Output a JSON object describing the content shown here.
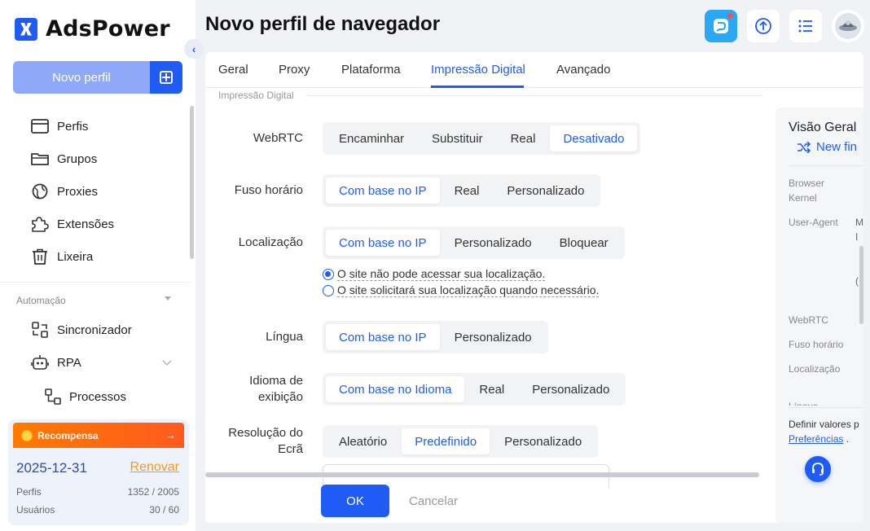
{
  "app": {
    "brand": "AdsPower",
    "page_title": "Novo perfil de navegador"
  },
  "sidebar": {
    "new_profile_label": "Novo perfil",
    "items": [
      {
        "label": "Perfis",
        "icon": "browser-window-icon"
      },
      {
        "label": "Grupos",
        "icon": "folder-icon"
      },
      {
        "label": "Proxies",
        "icon": "globe-icon"
      },
      {
        "label": "Extensões",
        "icon": "puzzle-icon"
      },
      {
        "label": "Lixeira",
        "icon": "trash-icon"
      }
    ],
    "automation_title": "Automação",
    "automation_items": [
      {
        "label": "Sincronizador",
        "icon": "sync-icon"
      },
      {
        "label": "RPA",
        "icon": "robot-icon"
      }
    ],
    "rpa_sub_item": "Processos"
  },
  "reward": {
    "title": "Recompensa",
    "arrow": "→",
    "date": "2025-12-31",
    "renew": "Renovar",
    "profiles_label": "Perfis",
    "profiles_value": "1352 / 2005",
    "users_label": "Usuários",
    "users_value": "30 / 60"
  },
  "tabs": [
    "Geral",
    "Proxy",
    "Plataforma",
    "Impressão Digital",
    "Avançado"
  ],
  "active_tab": "Impressão Digital",
  "section_label": "Impressão Digital",
  "form": {
    "webrtc": {
      "label": "WebRTC",
      "options": [
        "Encaminhar",
        "Substituir",
        "Real",
        "Desativado"
      ],
      "selected": "Desativado"
    },
    "timezone": {
      "label": "Fuso horário",
      "options": [
        "Com base no IP",
        "Real",
        "Personalizado"
      ],
      "selected": "Com base no IP"
    },
    "location": {
      "label": "Localização",
      "options": [
        "Com base no IP",
        "Personalizado",
        "Bloquear"
      ],
      "selected": "Com base no IP",
      "radios": [
        {
          "text": "O site não pode acessar sua localização.",
          "checked": true
        },
        {
          "text": "O site solicitará sua localização quando necessário.",
          "checked": false
        }
      ]
    },
    "language": {
      "label": "Língua",
      "options": [
        "Com base no IP",
        "Personalizado"
      ],
      "selected": "Com base no IP"
    },
    "display_language": {
      "label_line1": "Idioma de",
      "label_line2": "exibição",
      "options": [
        "Com base no Idioma",
        "Real",
        "Personalizado"
      ],
      "selected": "Com base no Idioma"
    },
    "resolution": {
      "label_line1": "Resolução do",
      "label_line2": "Ecrã",
      "options": [
        "Aleatório",
        "Predefinido",
        "Personalizado"
      ],
      "selected": "Predefinido"
    }
  },
  "buttons": {
    "ok": "OK",
    "cancel": "Cancelar"
  },
  "overview": {
    "title": "Visão Geral",
    "new_fingerprint": "New fin",
    "keys": {
      "browser_kernel_1": "Browser",
      "browser_kernel_2": "Kernel",
      "user_agent": "User-Agent",
      "user_agent_val_1": "M",
      "user_agent_val_2": "I",
      "user_agent_val_3": "(",
      "webrtc": "WebRTC",
      "timezone": "Fuso horário",
      "location": "Localização",
      "language": "Língua"
    },
    "footer_line": "Definir valores p",
    "footer_link": "Preferências",
    "footer_end": " ."
  },
  "colors": {
    "accent": "#1e5cf5",
    "reward": "#ff6a10",
    "renew": "#f29a1c"
  }
}
